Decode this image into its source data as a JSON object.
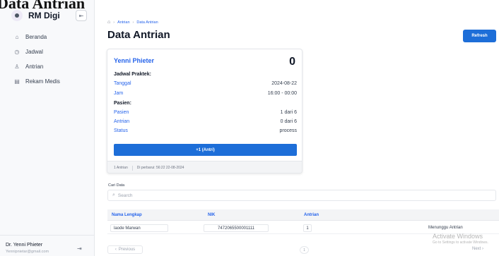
{
  "overlay_heading": "Data Antrian",
  "sidebar": {
    "brand": "RM Digi",
    "collapse_icon": "sidebar-collapse-icon",
    "items": [
      {
        "label": "Beranda",
        "icon": "home-icon"
      },
      {
        "label": "Jadwal",
        "icon": "clock-icon"
      },
      {
        "label": "Antrian",
        "icon": "queue-icon"
      },
      {
        "label": "Rekam Medis",
        "icon": "document-icon"
      }
    ],
    "user": {
      "name": "Dr. Yenni Phieter",
      "email": "Yennipnietar@gmail.com"
    }
  },
  "breadcrumb": [
    "Antrian",
    "Data Antrian"
  ],
  "page_title": "Data Antrian",
  "refresh_label": "Refresh",
  "card": {
    "doctor_name": "Yenni Phieter",
    "count": "0",
    "schedule_heading": "Jadwal Praktek:",
    "schedule": [
      {
        "key": "Tanggal",
        "value": "2024-08-22"
      },
      {
        "key": "Jam",
        "value": "16:00 - 00:00"
      }
    ],
    "patient_heading": "Pasien:",
    "patient": [
      {
        "key": "Pasien",
        "value": "1 dari 6"
      },
      {
        "key": "Antrian",
        "value": "0 dari 6"
      },
      {
        "key": "Status",
        "value": "process"
      }
    ],
    "button_label": "+1 (Antri)",
    "footer_left": "1 Antrian",
    "footer_right": "Di perbarui: 56:22 22-08-2024"
  },
  "search": {
    "label": "Cari Data",
    "placeholder": "Search"
  },
  "table": {
    "headers": [
      "Nama Lengkap",
      "NIK",
      "Antrian"
    ],
    "rows": [
      {
        "nama": "laode Marwan",
        "nik": "7472065500001111",
        "antrian": "1",
        "status": "Menunggu Antrian"
      }
    ]
  },
  "pagination": {
    "prev": "Previous",
    "page": "1",
    "next": "Next"
  },
  "watermark": {
    "line1": "Activate Windows",
    "line2": "Go to Settings to activate Windows."
  },
  "colors": {
    "accent": "#1d6ed8",
    "link": "#2563eb"
  }
}
